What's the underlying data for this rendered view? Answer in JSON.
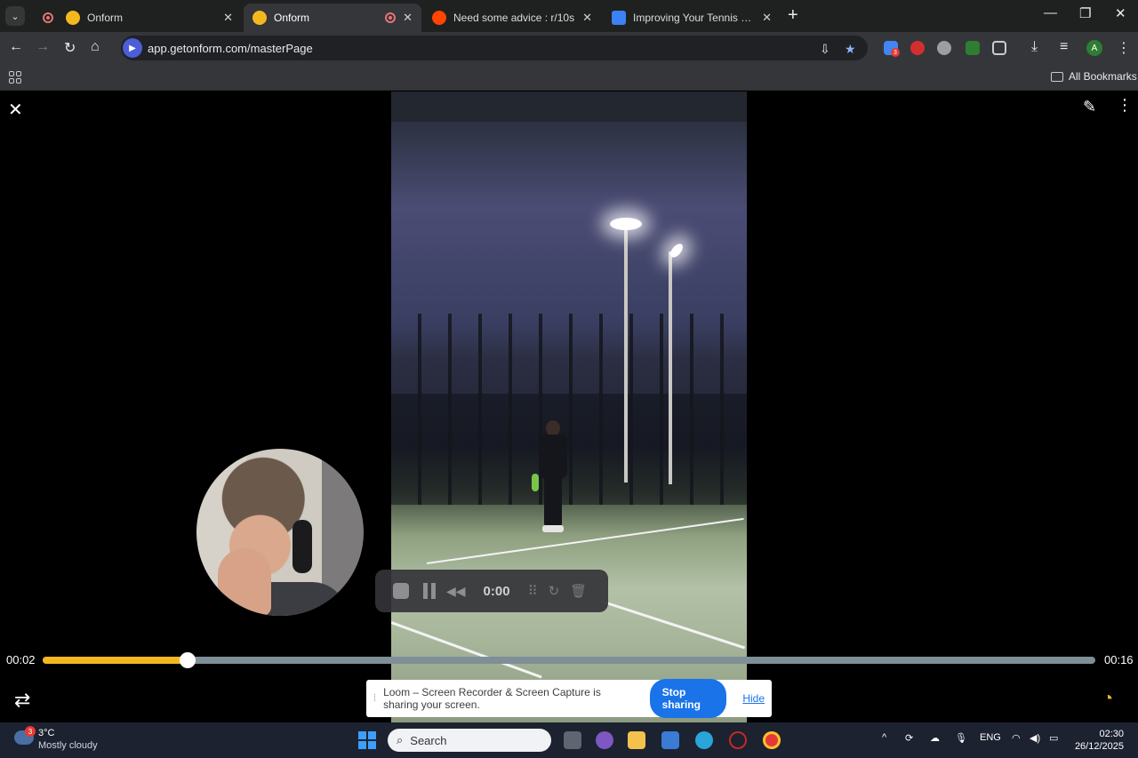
{
  "browser": {
    "tabs": [
      {
        "title": "Onform",
        "active": false
      },
      {
        "title": "Onform",
        "active": true
      },
      {
        "title": "Need some advice : r/10s",
        "active": false
      },
      {
        "title": "Improving Your Tennis Serve Te",
        "active": false
      }
    ],
    "url": "app.getonform.com/masterPage",
    "profile_initial": "A",
    "extension_badge": "3",
    "bookmarks_label": "All Bookmarks"
  },
  "recorder": {
    "time": "0:00"
  },
  "timeline": {
    "current": "00:02",
    "total": "00:16",
    "progress": 0.1375
  },
  "loom": {
    "message": "Loom – Screen Recorder & Screen Capture is sharing your screen.",
    "stop_label": "Stop sharing",
    "hide_label": "Hide"
  },
  "taskbar": {
    "weather_badge": "3",
    "temperature": "3°C",
    "condition": "Mostly cloudy",
    "search_placeholder": "Search",
    "language": "ENG",
    "time": "02:30",
    "date": "26/12/2025"
  },
  "colors": {
    "accent": "#f4b81f",
    "loom_blue": "#1a73e8",
    "track": "#7f8f98"
  }
}
